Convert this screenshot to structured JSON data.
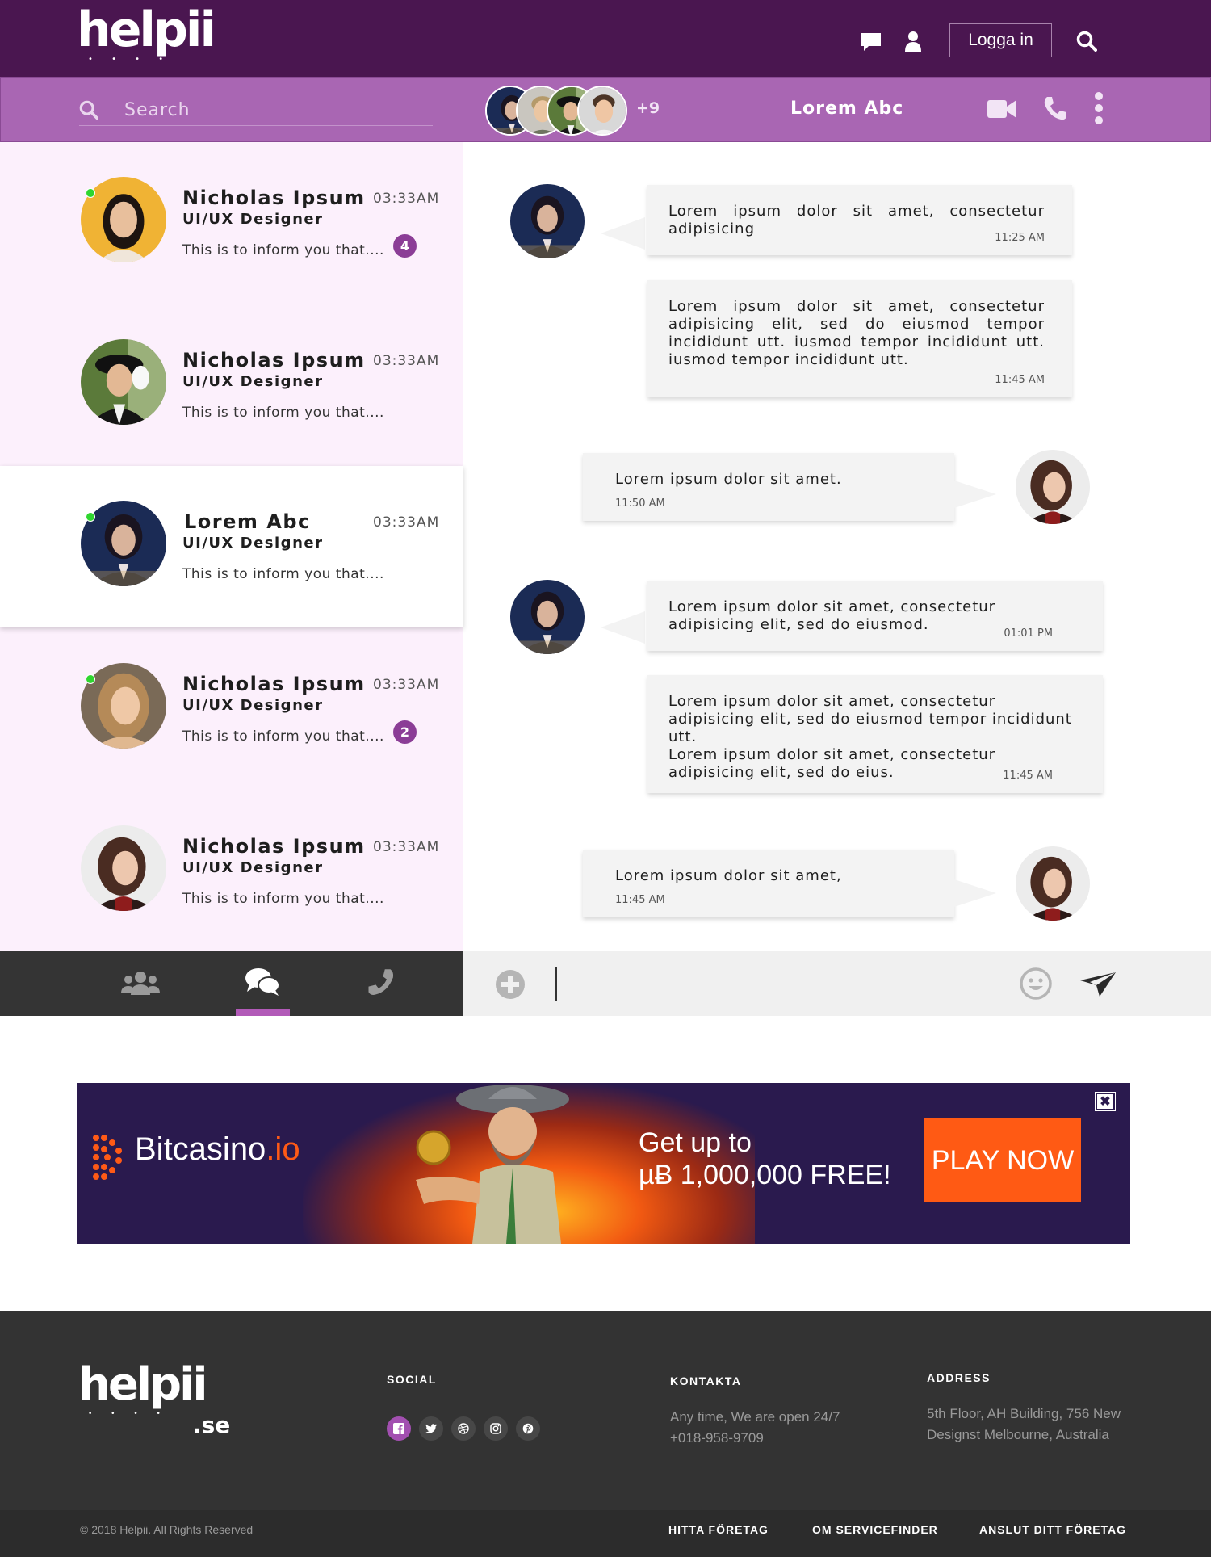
{
  "brand": {
    "logo": "helpii",
    "footer_logo": "helpii",
    "footer_logo_suffix": ".se"
  },
  "topbar": {
    "login_label": "Logga in"
  },
  "chatbar": {
    "search_placeholder": "Search",
    "extra_members": "+9",
    "title": "Lorem Abc"
  },
  "contacts": [
    {
      "name": "Nicholas Ipsum",
      "role": "UI/UX Designer",
      "time": "03:33AM",
      "preview": "This is to inform you that....",
      "badge": "4",
      "online": true
    },
    {
      "name": "Nicholas Ipsum",
      "role": "UI/UX Designer",
      "time": "03:33AM",
      "preview": "This is to inform you that....",
      "badge": "",
      "online": false
    },
    {
      "name": "Lorem Abc",
      "role": "UI/UX Designer",
      "time": "03:33AM",
      "preview": "This is to inform you that....",
      "badge": "",
      "online": true,
      "active": true
    },
    {
      "name": "Nicholas Ipsum",
      "role": "UI/UX Designer",
      "time": "03:33AM",
      "preview": "This is to inform you that....",
      "badge": "2",
      "online": true
    },
    {
      "name": "Nicholas Ipsum",
      "role": "UI/UX Designer",
      "time": "03:33AM",
      "preview": "This is to inform you that....",
      "badge": "",
      "online": false
    }
  ],
  "messages": [
    {
      "side": "in",
      "text": "Lorem ipsum dolor sit amet, consectetur adipisicing",
      "time": "11:25 AM"
    },
    {
      "side": "in",
      "text": "Lorem ipsum dolor sit amet, consectetur adipisicing elit, sed do eiusmod tempor incididunt utt. iusmod tempor incididunt utt. iusmod tempor incididunt utt.",
      "time": "11:45 AM"
    },
    {
      "side": "out",
      "text": "Lorem ipsum dolor sit amet.",
      "time": "11:50 AM"
    },
    {
      "side": "in",
      "text": "Lorem ipsum dolor sit amet, consectetur adipisicing elit, sed do eiusmod.",
      "time": "01:01 PM"
    },
    {
      "side": "in",
      "text": "Lorem ipsum dolor sit amet, consectetur adipisicing elit, sed do eiusmod tempor incididunt utt.\nLorem ipsum dolor sit amet, consectetur adipisicing elit, sed do eius.",
      "time": "11:45 AM"
    },
    {
      "side": "out",
      "text": "Lorem ipsum dolor sit amet,",
      "time": "11:45 AM"
    }
  ],
  "ad": {
    "brand_name": "Bitcasino",
    "brand_tld": ".io",
    "headline_1": "Get up to",
    "headline_2": "µɃ 1,000,000 FREE!",
    "cta": "PLAY NOW"
  },
  "footer": {
    "social_heading": "SOCIAL",
    "contact_heading": "KONTAKTA",
    "contact_line1": "Any time, We are open 24/7",
    "contact_line2": "+018-958-9709",
    "address_heading": "ADDRESS",
    "address_line1": "5th Floor, AH Building, 756 New",
    "address_line2": "Designst Melbourne, Australia",
    "copyright": "© 2018 Helpii. All Rights Reserved",
    "links": [
      "HITTA FÖRETAG",
      "OM SERVICEFINDER",
      "ANSLUT DITT FÖRETAG"
    ]
  },
  "colors": {
    "topbar": "#4a1650",
    "chatbar": "#a966b3",
    "list_bg": "#fcf0fc",
    "badge": "#8b3d96",
    "online": "#2fd62f",
    "ad_cta": "#ff5a14",
    "footer": "#333333"
  },
  "icons": [
    "chat-icon",
    "user-icon",
    "search-icon",
    "video-camera-icon",
    "phone-icon",
    "more-vertical-icon",
    "group-icon",
    "chat-bubbles-icon",
    "add-circle-icon",
    "emoji-icon",
    "send-icon",
    "close-icon",
    "facebook-icon",
    "twitter-icon",
    "dribbble-icon",
    "instagram-icon",
    "pinterest-icon"
  ]
}
